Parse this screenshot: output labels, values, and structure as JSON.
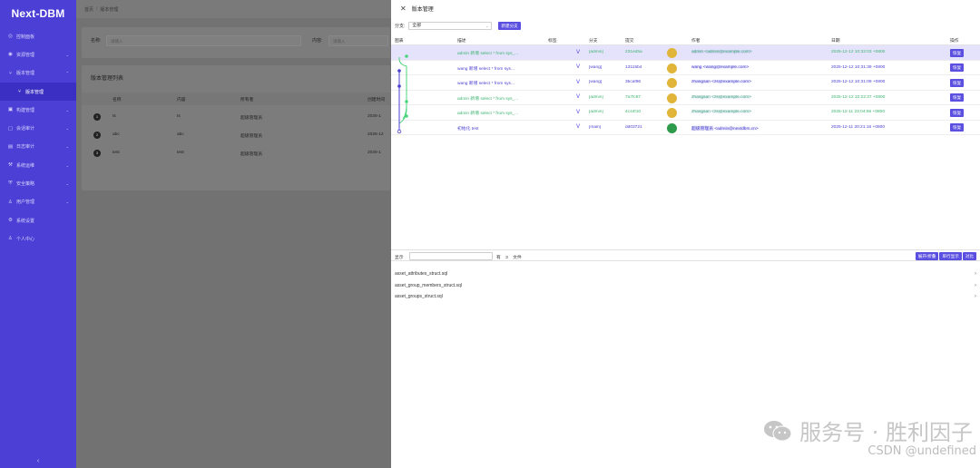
{
  "app": {
    "title": "Next-DBM"
  },
  "sidebar": {
    "items": [
      {
        "label": "控制面板",
        "icon": "dashboard-icon",
        "glyph": "◎"
      },
      {
        "label": "资源管理",
        "icon": "database-icon",
        "glyph": "◉",
        "caret": "⌄"
      },
      {
        "label": "版本管理",
        "icon": "branch-icon",
        "glyph": "⑂",
        "caret": "⌃"
      },
      {
        "label": "版本管理",
        "icon": "branch-icon",
        "glyph": "⑂",
        "sub": true
      },
      {
        "label": "构建管理",
        "icon": "build-icon",
        "glyph": "▣",
        "caret": "⌄"
      },
      {
        "label": "会话审计",
        "icon": "session-icon",
        "glyph": "▢",
        "caret": "⌄"
      },
      {
        "label": "日志审计",
        "icon": "log-icon",
        "glyph": "▤",
        "caret": "⌄"
      },
      {
        "label": "系统运维",
        "icon": "ops-icon",
        "glyph": "⚒",
        "caret": "⌄"
      },
      {
        "label": "安全策略",
        "icon": "shield-icon",
        "glyph": "⛨",
        "caret": "⌄"
      },
      {
        "label": "用户管理",
        "icon": "user-icon",
        "glyph": "♙",
        "caret": "⌄"
      },
      {
        "label": "系统设置",
        "icon": "gear-icon",
        "glyph": "⚙"
      },
      {
        "label": "个人中心",
        "icon": "person-icon",
        "glyph": "♙"
      }
    ],
    "collapse_glyph": "‹"
  },
  "main": {
    "breadcrumb": [
      "首页",
      "版本管理"
    ],
    "breadcrumb_sep": "/",
    "search": {
      "name_label": "名称:",
      "name_placeholder": "请输入",
      "content_label": "内容:",
      "content_placeholder": "请输入"
    },
    "list_title": "版本管理列表",
    "columns": [
      "名称",
      "内容",
      "所有者",
      "创建时间"
    ],
    "rows": [
      {
        "idx": "1",
        "name": "ts",
        "content": "ts",
        "owner": "超级管理员",
        "time": "2025-1"
      },
      {
        "idx": "2",
        "name": "abc",
        "content": "abc",
        "owner": "超级管理员",
        "time": "2025-12"
      },
      {
        "idx": "3",
        "name": "test",
        "content": "test",
        "owner": "超级管理员",
        "time": "2025-1"
      }
    ]
  },
  "drawer": {
    "title": "版本管理",
    "close_glyph": "✕",
    "branch_label": "分支:",
    "branch_value": "全部",
    "new_branch_button": "新建分支",
    "columns": [
      "图表",
      "描述",
      "标签",
      "分支",
      "提交",
      "作者",
      "日期",
      "操作"
    ],
    "commits": [
      {
        "desc": "admin 新增 select * from sys_...",
        "branch": "[admin]",
        "hash": "231ed5a",
        "author": "admin <admin@example.com>",
        "date": "2025-12-12 10:32:03 +0800",
        "color": "green",
        "avatar": "#e0b53a",
        "highlight": true
      },
      {
        "desc": "wang 新增 select * from sys...",
        "branch": "[wang]",
        "hash": "13115b4",
        "author": "wang <wang@example.com>",
        "date": "2025-12-12 10:31:39 +0800",
        "color": "blue",
        "avatar": "#e0b53a"
      },
      {
        "desc": "wang 新增 select * from sys...",
        "branch": "[wang]",
        "hash": "3bcaf96",
        "author": "zhangsan <zs@example.com>",
        "date": "2025-12-12 10:31:09 +0800",
        "color": "blue",
        "avatar": "#e0b53a"
      },
      {
        "desc": "admin 新增 select * from sys_...",
        "branch": "[admin]",
        "hash": "7a7fc87",
        "author": "zhangsan <zs@example.com>",
        "date": "2025-12-12 10:22:37 +0800",
        "color": "green",
        "avatar": "#e0b53a"
      },
      {
        "desc": "admin 新增 select * from sys_...",
        "branch": "[admin]",
        "hash": "4c44f10",
        "author": "zhangsan <zs@example.com>",
        "date": "2025-12-11 23:04:56 +0800",
        "color": "green",
        "avatar": "#e0b53a"
      },
      {
        "desc": "初始化 test",
        "branch": "[main]",
        "hash": "dd03721",
        "author": "超级管理员 <admin@nextdbm.cn>",
        "date": "2025-12-11 20:21:16 +0800",
        "color": "blue",
        "avatar": "#2e9a4b"
      }
    ],
    "restore_label": "恢复",
    "files": {
      "show_label": "显示",
      "count_prefix": "有",
      "count": "3",
      "count_suffix": "文件",
      "buttons": [
        "展开/折叠",
        "单行显示",
        "对比"
      ],
      "items": [
        "asset_attributes_struct.sql",
        "asset_group_members_struct.sql",
        "asset_groups_struct.sql"
      ]
    }
  },
  "watermark": {
    "text": "服务号 · 胜利因子",
    "csdn": "CSDN @undefined"
  }
}
